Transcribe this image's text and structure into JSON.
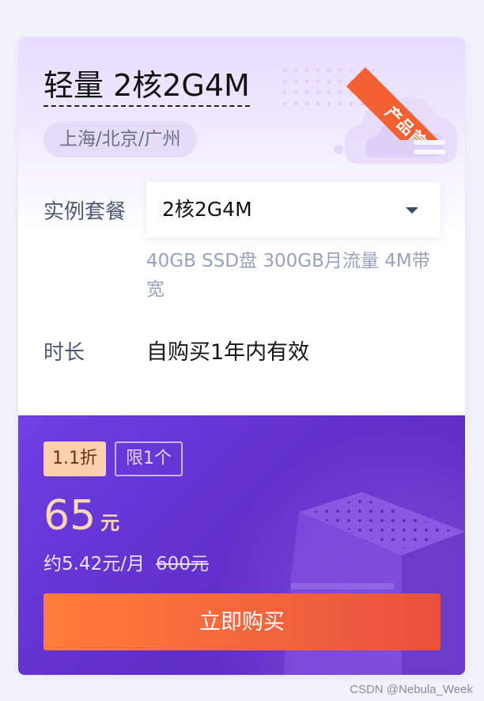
{
  "product": {
    "title": "轻量 2核2G4M",
    "region": "上海/北京/广州",
    "ribbon": "产品首单"
  },
  "plan": {
    "label": "实例套餐",
    "selected": "2核2G4M",
    "spec": "40GB SSD盘 300GB月流量 4M带宽"
  },
  "duration": {
    "label": "时长",
    "value": "自购买1年内有效"
  },
  "pricing": {
    "discount_badge": "1.1折",
    "limit_badge": "限1个",
    "price": "65",
    "unit": "元",
    "monthly": "约5.42元/月",
    "original": "600元"
  },
  "buy_button": "立即购买",
  "watermark": "CSDN @Nebula_Week",
  "colors": {
    "accent_orange": "#f26034",
    "purple": "#6231cd",
    "price": "#ffd9b6"
  }
}
